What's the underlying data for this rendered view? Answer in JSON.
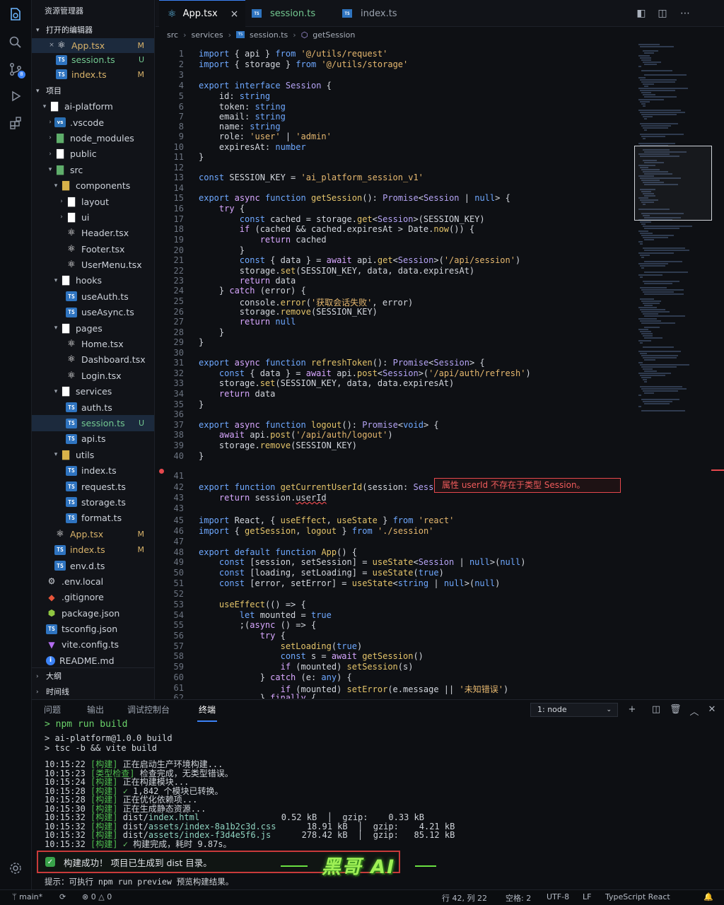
{
  "activity": {
    "explorer_badge": "",
    "scm_badge": "8"
  },
  "sidebar": {
    "title": "资源管理器",
    "open_editors": {
      "title": "打开的编辑器",
      "items": [
        {
          "name": "App.tsx",
          "status": "M"
        },
        {
          "name": "session.ts",
          "status": "U"
        },
        {
          "name": "index.ts",
          "status": "M"
        }
      ]
    },
    "project": {
      "title": "项目",
      "root": "ai-platform",
      "tree": [
        {
          "name": ".vscode"
        },
        {
          "name": "node_modules"
        },
        {
          "name": "public"
        },
        {
          "name": "src"
        },
        {
          "name": "components"
        },
        {
          "name": "layout"
        },
        {
          "name": "ui"
        },
        {
          "name": "Header.tsx"
        },
        {
          "name": "Footer.tsx"
        },
        {
          "name": "UserMenu.tsx"
        },
        {
          "name": "hooks"
        },
        {
          "name": "useAuth.ts"
        },
        {
          "name": "useAsync.ts"
        },
        {
          "name": "pages"
        },
        {
          "name": "Home.tsx"
        },
        {
          "name": "Dashboard.tsx"
        },
        {
          "name": "Login.tsx"
        },
        {
          "name": "services"
        },
        {
          "name": "auth.ts"
        },
        {
          "name": "session.ts",
          "status": "U"
        },
        {
          "name": "api.ts"
        },
        {
          "name": "utils"
        },
        {
          "name": "index.ts"
        },
        {
          "name": "request.ts"
        },
        {
          "name": "storage.ts"
        },
        {
          "name": "format.ts"
        },
        {
          "name": "App.tsx",
          "status": "M"
        },
        {
          "name": "index.ts",
          "status": "M"
        },
        {
          "name": "env.d.ts"
        },
        {
          "name": ".env.local"
        },
        {
          "name": ".gitignore"
        },
        {
          "name": "package.json"
        },
        {
          "name": "tsconfig.json"
        },
        {
          "name": "vite.config.ts"
        },
        {
          "name": "README.md"
        }
      ]
    },
    "outline": "大纲",
    "timeline": "时间线"
  },
  "tabs": [
    {
      "label": "App.tsx",
      "close": "×"
    },
    {
      "label": "session.ts"
    },
    {
      "label": "index.ts"
    }
  ],
  "breadcrumb": [
    "src",
    "services",
    "session.ts",
    "getSession"
  ],
  "editor": {
    "error_message": "属性 userId 不存在于类型 Session。"
  },
  "panel": {
    "tabs": [
      "问题",
      "输出",
      "调试控制台",
      "终端"
    ],
    "terminal_select": "1: node",
    "success_text": "构建成功！ 项目已生成到 dist 目录。",
    "hint_text": "提示：可执行 npm run preview 预览构建结果。",
    "logo_text": "黑哥 AI"
  },
  "statusbar": {
    "branch": "main*",
    "errors": "0",
    "warnings": "0",
    "position": "行 42, 列 22",
    "spaces": "空格: 2",
    "encoding": "UTF-8",
    "eol": "LF",
    "language": "TypeScript React"
  },
  "colors": {
    "accent": "#3b82f6",
    "error": "#e5484d",
    "success": "#39a24a",
    "logo": "#9ff055"
  }
}
